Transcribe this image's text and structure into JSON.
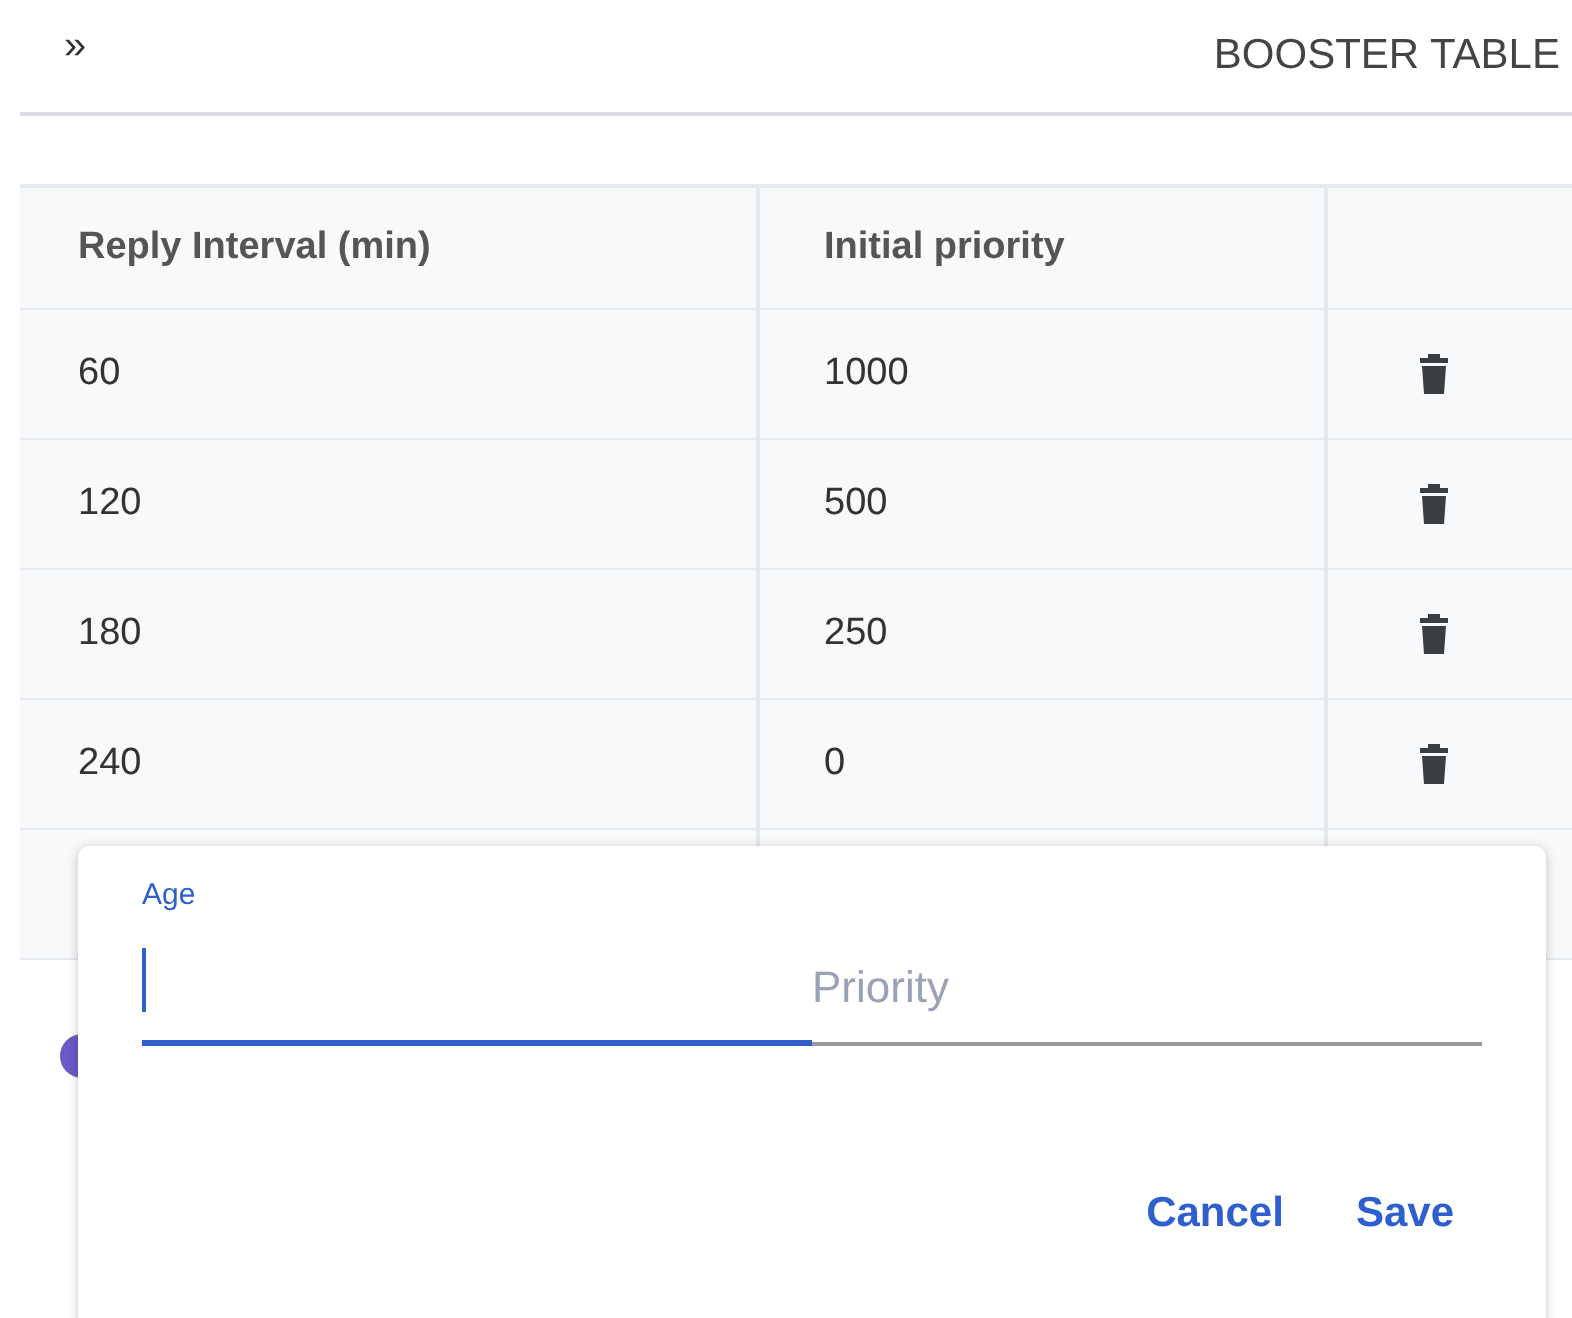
{
  "header": {
    "expand_icon": "»",
    "title": "BOOSTER TABLE"
  },
  "table": {
    "columns": [
      "Reply Interval (min)",
      "Initial priority"
    ],
    "rows": [
      {
        "cells": [
          "60",
          "1000"
        ]
      },
      {
        "cells": [
          "120",
          "500"
        ]
      },
      {
        "cells": [
          "180",
          "250"
        ]
      },
      {
        "cells": [
          "240",
          "0"
        ]
      }
    ]
  },
  "dialog": {
    "fields": [
      {
        "label": "Age",
        "focused": true
      },
      {
        "placeholder": "Priority",
        "focused": false
      }
    ],
    "buttons": [
      "Cancel",
      "Save"
    ]
  }
}
